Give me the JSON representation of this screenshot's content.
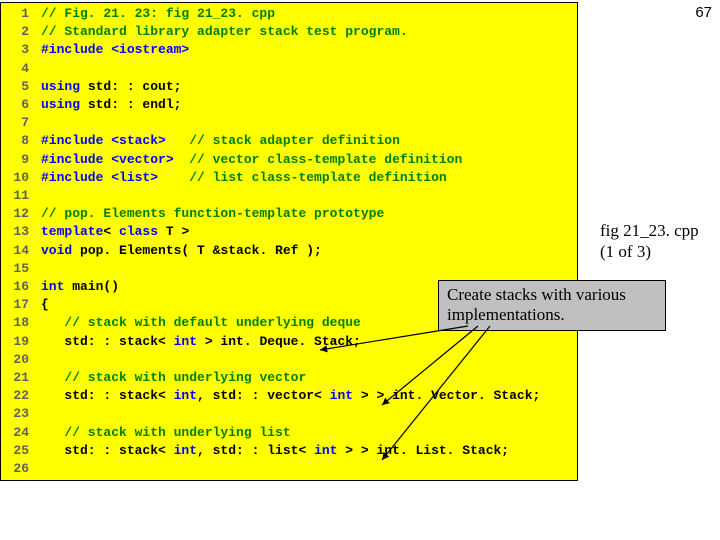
{
  "page_number": "67",
  "caption": {
    "line1": "fig 21_23. cpp",
    "line2": "(1 of 3)"
  },
  "callout": "Create stacks with various implementations.",
  "code": {
    "lines": [
      {
        "n": "1",
        "tokens": [
          [
            "comment",
            "// Fig. 21. 23: fig 21_23. cpp"
          ]
        ]
      },
      {
        "n": "2",
        "tokens": [
          [
            "comment",
            "// Standard library adapter stack test program."
          ]
        ]
      },
      {
        "n": "3",
        "tokens": [
          [
            "preproc",
            "#include "
          ],
          [
            "preproc",
            "<iostream>"
          ]
        ]
      },
      {
        "n": "4",
        "tokens": [
          [
            "plain",
            ""
          ]
        ]
      },
      {
        "n": "5",
        "tokens": [
          [
            "keyword",
            "using "
          ],
          [
            "plain",
            "std: : cout;"
          ]
        ]
      },
      {
        "n": "6",
        "tokens": [
          [
            "keyword",
            "using "
          ],
          [
            "plain",
            "std: : endl;"
          ]
        ]
      },
      {
        "n": "7",
        "tokens": [
          [
            "plain",
            ""
          ]
        ]
      },
      {
        "n": "8",
        "tokens": [
          [
            "preproc",
            "#include "
          ],
          [
            "preproc",
            "<stack>   "
          ],
          [
            "comment",
            "// stack adapter definition"
          ]
        ]
      },
      {
        "n": "9",
        "tokens": [
          [
            "preproc",
            "#include "
          ],
          [
            "preproc",
            "<vector>  "
          ],
          [
            "comment",
            "// vector class-template definition"
          ]
        ]
      },
      {
        "n": "10",
        "tokens": [
          [
            "preproc",
            "#include "
          ],
          [
            "preproc",
            "<list>    "
          ],
          [
            "comment",
            "// list class-template definition"
          ]
        ]
      },
      {
        "n": "11",
        "tokens": [
          [
            "plain",
            ""
          ]
        ]
      },
      {
        "n": "12",
        "tokens": [
          [
            "comment",
            "// pop. Elements function-template prototype"
          ]
        ]
      },
      {
        "n": "13",
        "tokens": [
          [
            "keyword",
            "template"
          ],
          [
            "plain",
            "< "
          ],
          [
            "keyword",
            "class"
          ],
          [
            "plain",
            " T >"
          ]
        ]
      },
      {
        "n": "14",
        "tokens": [
          [
            "keyword",
            "void"
          ],
          [
            "plain",
            " pop. Elements( T &stack. Ref );"
          ]
        ]
      },
      {
        "n": "15",
        "tokens": [
          [
            "plain",
            ""
          ]
        ]
      },
      {
        "n": "16",
        "tokens": [
          [
            "keyword",
            "int"
          ],
          [
            "plain",
            " main()"
          ]
        ]
      },
      {
        "n": "17",
        "tokens": [
          [
            "plain",
            "{"
          ]
        ]
      },
      {
        "n": "18",
        "tokens": [
          [
            "plain",
            "   "
          ],
          [
            "comment",
            "// stack with default underlying deque"
          ]
        ]
      },
      {
        "n": "19",
        "tokens": [
          [
            "plain",
            "   std: : stack< "
          ],
          [
            "keyword",
            "int"
          ],
          [
            "plain",
            " > int. Deque. Stack;"
          ]
        ]
      },
      {
        "n": "20",
        "tokens": [
          [
            "plain",
            ""
          ]
        ]
      },
      {
        "n": "21",
        "tokens": [
          [
            "plain",
            "   "
          ],
          [
            "comment",
            "// stack with underlying vector"
          ]
        ]
      },
      {
        "n": "22",
        "tokens": [
          [
            "plain",
            "   std: : stack< "
          ],
          [
            "keyword",
            "int"
          ],
          [
            "plain",
            ", std: : vector< "
          ],
          [
            "keyword",
            "int"
          ],
          [
            "plain",
            " > > int. Vector. Stack;"
          ]
        ]
      },
      {
        "n": "23",
        "tokens": [
          [
            "plain",
            ""
          ]
        ]
      },
      {
        "n": "24",
        "tokens": [
          [
            "plain",
            "   "
          ],
          [
            "comment",
            "// stack with underlying list"
          ]
        ]
      },
      {
        "n": "25",
        "tokens": [
          [
            "plain",
            "   std: : stack< "
          ],
          [
            "keyword",
            "int"
          ],
          [
            "plain",
            ", std: : list< "
          ],
          [
            "keyword",
            "int"
          ],
          [
            "plain",
            " > > int. List. Stack;"
          ]
        ]
      },
      {
        "n": "26",
        "tokens": [
          [
            "plain",
            ""
          ]
        ]
      }
    ]
  }
}
